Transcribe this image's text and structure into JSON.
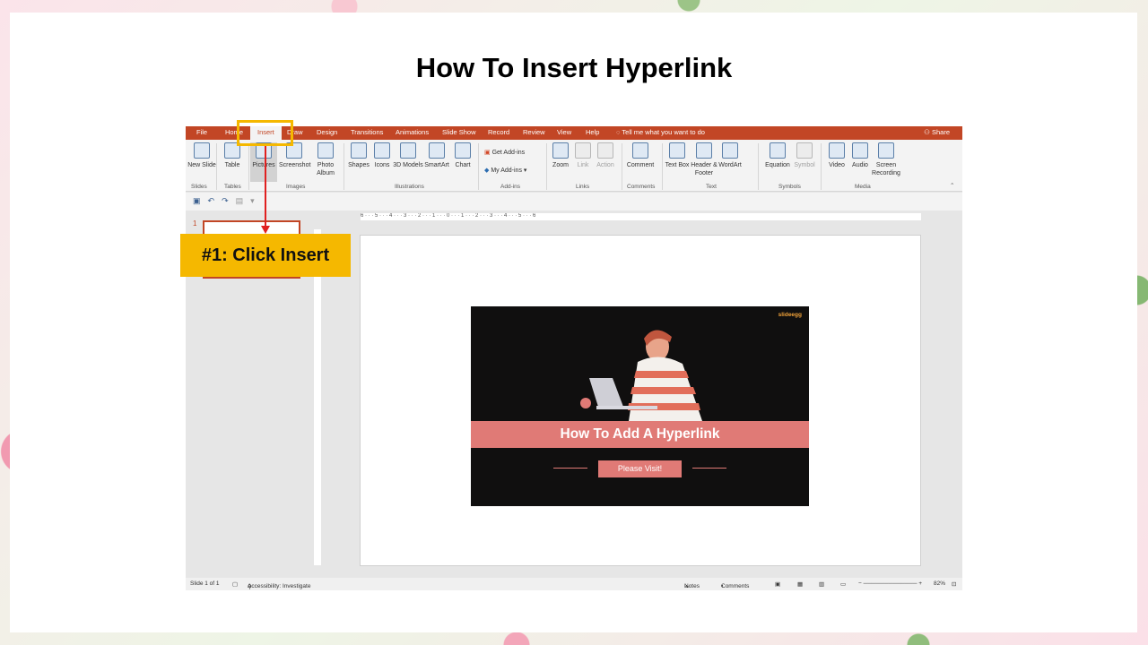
{
  "page": {
    "title": "How To Insert Hyperlink"
  },
  "ppt": {
    "tabs": [
      "File",
      "Home",
      "Insert",
      "Draw",
      "Design",
      "Transitions",
      "Animations",
      "Slide Show",
      "Record",
      "Review",
      "View",
      "Help"
    ],
    "active_tab": "Insert",
    "tell_me": "Tell me what you want to do",
    "share": "Share",
    "ribbon": {
      "new_slide": "New Slide",
      "table": "Table",
      "pictures": "Pictures",
      "screenshot": "Screenshot",
      "photo_album": "Photo Album",
      "shapes": "Shapes",
      "icons": "Icons",
      "models_3d": "3D Models",
      "smartart": "SmartArt",
      "chart": "Chart",
      "get_addins": "Get Add-ins",
      "my_addins": "My Add-ins",
      "zoom": "Zoom",
      "link": "Link",
      "action": "Action",
      "comment": "Comment",
      "text_box": "Text Box",
      "header_footer": "Header & Footer",
      "wordart": "WordArt",
      "equation": "Equation",
      "symbol": "Symbol",
      "video": "Video",
      "audio": "Audio",
      "screen_recording": "Screen Recording"
    },
    "groups": {
      "slides": "Slides",
      "tables": "Tables",
      "images": "Images",
      "illustrations": "Illustrations",
      "addins": "Add-ins",
      "links": "Links",
      "comments": "Comments",
      "text": "Text",
      "symbols": "Symbols",
      "media": "Media"
    },
    "ruler_top": "6 · · · 5 · · · 4 · · · 3 · · · 2 · · · 1 · · · 0 · · · 1 · · · 2 · · · 3 · · · 4 · · · 5 · · · 6",
    "thumb_number": "1",
    "status": {
      "slide_of": "Slide 1 of 1",
      "accessibility": "Accessibility: Investigate",
      "notes": "Notes",
      "comments": "Comments",
      "zoom": "82%"
    }
  },
  "mini_slide": {
    "logo": "slideegg",
    "title": "How To Add A Hyperlink",
    "button": "Please Visit!"
  },
  "annotation": {
    "callout": "#1: Click Insert"
  }
}
